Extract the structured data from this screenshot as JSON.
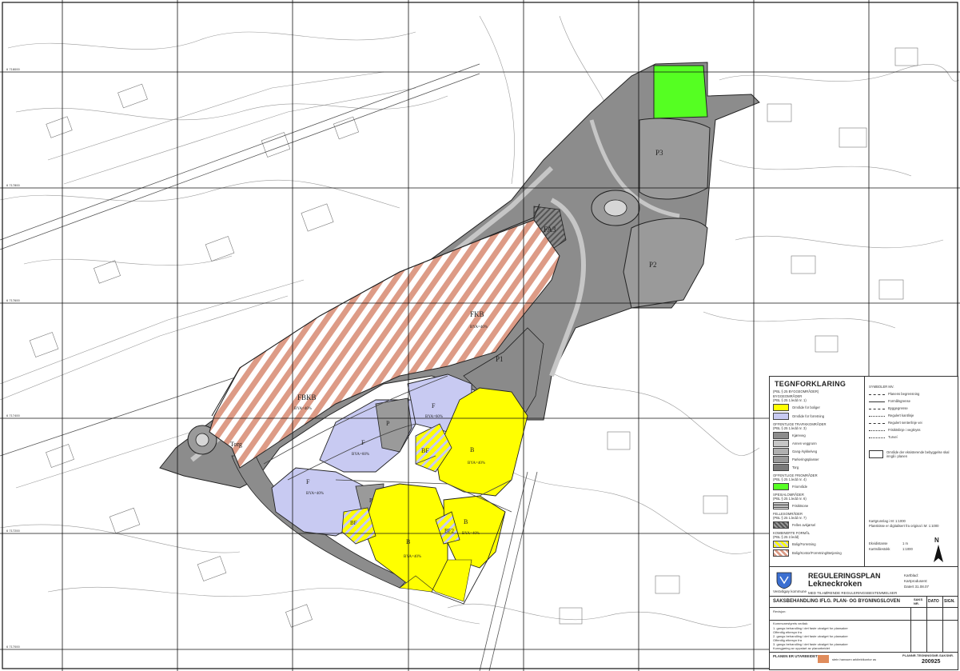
{
  "legend": {
    "title": "TEGNFORKLARING",
    "section_build": "(PBL § 25 BYGGEOMRÅDER)",
    "section_build2": "BYGGEOMRÅDER",
    "section_build3": "(PBL § 25 1.ledd nr. 1)",
    "item_housing": "Område for boliger",
    "item_shopping": "Område for forretning",
    "section_traffic": "OFFENTLIGE TRAFIKKOMRÅDER",
    "section_traffic2": "(PBL § 25 1.ledd nr. 3)",
    "item_road": "Kjøreveg",
    "item_other_road": "Annen veggrunn",
    "item_walk": "Gang-/sykkelveg",
    "item_parking": "Parkeringsplasser",
    "item_square": "Torg",
    "section_green": "OFFENTLIGE FRIOMRÅDER",
    "section_green2": "(PBL § 25 1.ledd nr. 4)",
    "item_park": "Friområde",
    "section_special": "SPESIALOMRÅDER",
    "section_special2": "(PBL § 25 1.ledd nr. 6)",
    "item_frisikt": "Frisiktsone",
    "section_common": "FELLESOMRÅDER",
    "section_common2": "(PBL § 25 1.ledd nr. 7)",
    "item_common_yard": "Felles avkjørsel",
    "section_combo": "KOMBINERTE FORMÅL",
    "section_combo2": "(PBL § 25 2.ledd)",
    "item_combo1": "Bolig/Forretning",
    "item_combo2": "Bolig/Kontor/Forretning/Betjening",
    "symbols_title": "SYMBOLER MV.",
    "sym_1": "Planens begrensning",
    "sym_2": "Formålsgrense",
    "sym_3": "Byggegrense",
    "sym_4": "Regulert kantlinje",
    "sym_5": "Regulert senterlinje vei",
    "sym_6": "Frisiktslinje i vegkryss",
    "sym_7": "Turveí",
    "sym_box": "Område der eksisterende bebyggelse skal inngå i planen",
    "scale_note1": "Kartgrunnlag i M: 1:1000",
    "scale_note2": "Planskisse er digitalisert fra original i M: 1:1000",
    "equidist_label": "Ekvidistanse",
    "equidist_value": "1 m",
    "scale_label": "Kartmålestokk",
    "scale_value": "1:1000",
    "north": "N"
  },
  "titleblock": {
    "plan_type": "REGULERINGSPLAN",
    "plan_name": "Lekneckroken",
    "subtitle": "MED TILHØRENDE REGULERINGSBESTEMMELSER",
    "municipality": "Vestvågøy kommune",
    "meta1": "Kartblad:",
    "meta2": "Kartprodusent:",
    "meta3": "Datert 31.08.07",
    "treatment": "SAKSBEHANDLING IFLG. PLAN- OG BYGNINGSLOVEN",
    "col_sak": "SAKS NR.",
    "col_date": "DATO",
    "col_sign": "SIGN.",
    "revision": "Revisjon:",
    "board": "Kommunestyrets vedtak:",
    "rows": [
      "1. gangs behandling i det faste utvalget for plansaker",
      "Offentlig ettersyn fra",
      "2. gangs behandling i det faste utvalget for plansaker",
      "Offentlig ettersyn fra",
      "3. gangs behandling i det faste utvalget for plansaker",
      "Kunngjøring av oppstart av planarbeidet"
    ],
    "made_by": "PLANEN ER UTARBEIDET AV:",
    "firm": "stein hanssen arkitektkontor as",
    "footer_plan": "PLANNR.",
    "footer_drawing": "TEGNINGSNR.",
    "footer_case": "SAKSNR.",
    "plan_no": "200925"
  },
  "map": {
    "zones": {
      "fa3": "FA3",
      "fkb": "FKB",
      "fkb_bya": "BYA=40%",
      "fkb2": "FBKB",
      "fkb2_bya": "BYA=40%",
      "torg": "Torg",
      "p1": "P1",
      "p2": "P2",
      "p3": "P3",
      "p": "P",
      "p_small": "P",
      "f1": "F",
      "f1_bya": "BYA=60%",
      "f2": "F",
      "f2_bya": "BYA=40%",
      "f3": "F",
      "f3_bya": "BYA=60%",
      "b1": "B",
      "b1_bya": "BYA=40%",
      "b2": "B",
      "b2_bya": "BYA=40%",
      "b3": "B",
      "b3_bya": "BYA=40%",
      "bf1": "BF",
      "bf2": "BF",
      "bf3": "BF2"
    },
    "grid_labels": {
      "y1": "6 718000",
      "y2": "6 717800",
      "y3": "6 717600",
      "y4": "6 717400",
      "y5": "6 717200",
      "y6": "6 717000"
    },
    "colors": {
      "housing": "#ffff00",
      "shopping": "#c8caf2",
      "road": "#8c8c8c",
      "other_road": "#c6c6c6",
      "parking": "#9a9a9a",
      "green": "#55ff22",
      "stripe": "#dd9b86"
    }
  }
}
